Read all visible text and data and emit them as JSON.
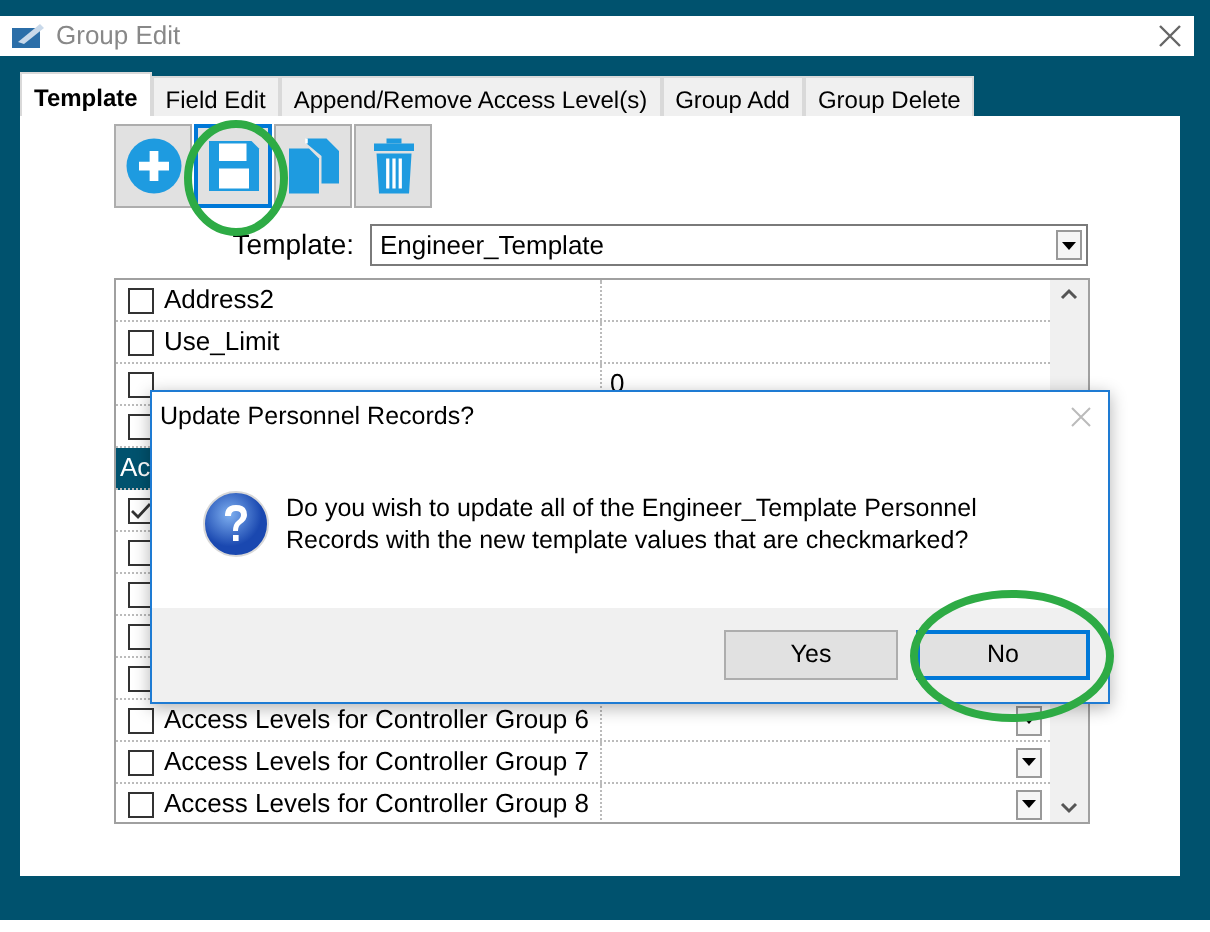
{
  "window": {
    "title": "Group Edit"
  },
  "tabs": [
    {
      "label": "Template",
      "selected": true
    },
    {
      "label": "Field Edit",
      "selected": false
    },
    {
      "label": "Append/Remove Access Level(s)",
      "selected": false
    },
    {
      "label": "Group Add",
      "selected": false
    },
    {
      "label": "Group Delete",
      "selected": false
    }
  ],
  "toolbar": [
    {
      "kind": "add",
      "selected": false
    },
    {
      "kind": "save",
      "selected": true
    },
    {
      "kind": "copy",
      "selected": false
    },
    {
      "kind": "delete",
      "selected": false
    }
  ],
  "template": {
    "label": "Template:",
    "value": "Engineer_Template"
  },
  "grid": {
    "rows": [
      {
        "kind": "field",
        "label": "Address2",
        "checked": false
      },
      {
        "kind": "field",
        "label": "Use_Limit",
        "checked": false
      },
      {
        "kind": "field",
        "value": "0",
        "checked": false
      },
      {
        "kind": "field",
        "checked": false
      },
      {
        "kind": "header",
        "label": "Ac"
      },
      {
        "kind": "field",
        "checked": true
      },
      {
        "kind": "field",
        "checked": false
      },
      {
        "kind": "field",
        "checked": false
      },
      {
        "kind": "field",
        "checked": false
      },
      {
        "kind": "field",
        "checked": false
      },
      {
        "kind": "dropdown",
        "label": "Access Levels for Controller Group 6",
        "checked": false
      },
      {
        "kind": "dropdown",
        "label": "Access Levels for Controller Group 7",
        "checked": false
      },
      {
        "kind": "dropdown",
        "label": "Access Levels for Controller Group 8",
        "checked": false
      }
    ]
  },
  "dialog": {
    "title": "Update Personnel Records?",
    "message": "Do you wish to update all of the Engineer_Template Personnel Records with the new template values that are checkmarked?",
    "buttons": [
      {
        "label": "Yes",
        "selected": false
      },
      {
        "label": "No",
        "selected": true
      }
    ]
  }
}
